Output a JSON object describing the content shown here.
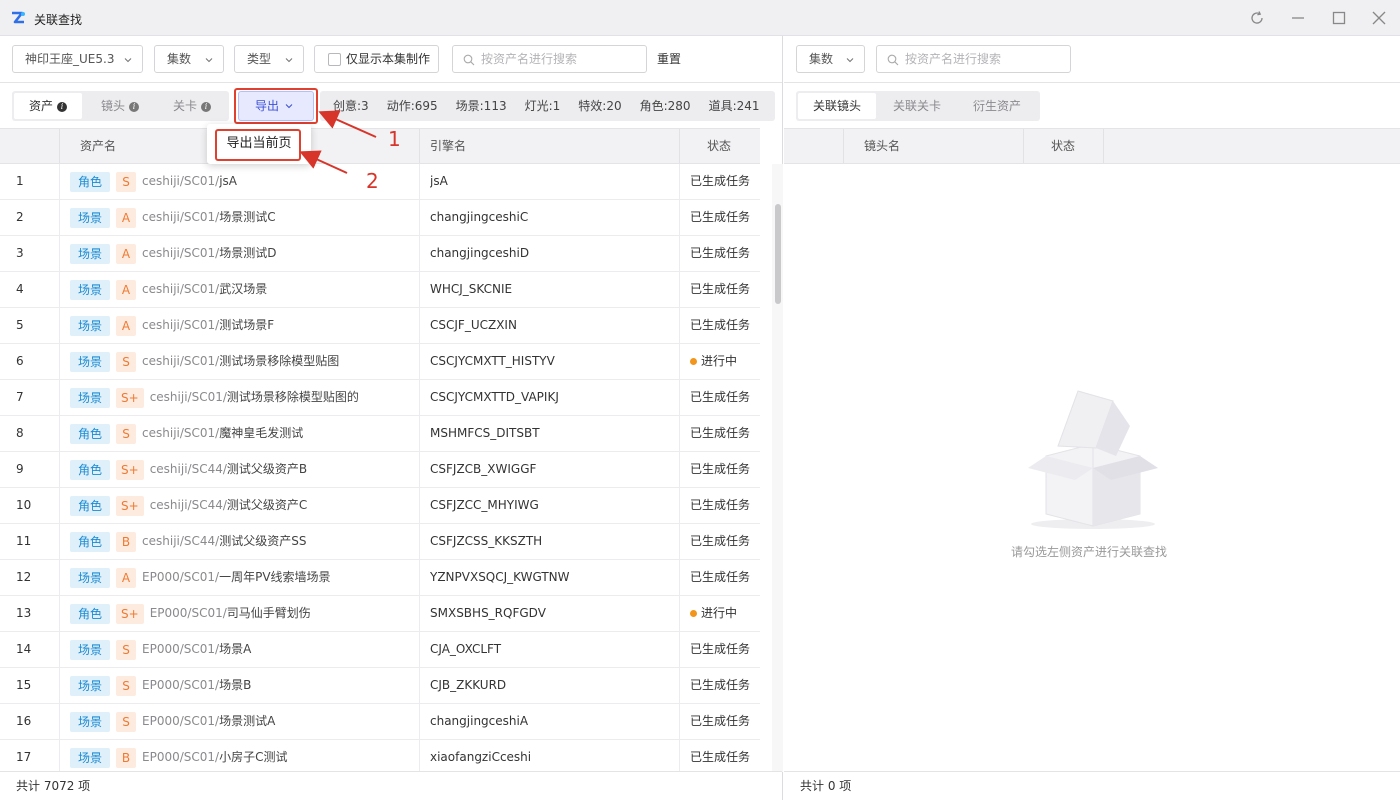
{
  "window": {
    "title": "关联查找",
    "icons": {
      "logo": "app-logo-icon",
      "refresh": "refresh-icon",
      "minimize": "minimize-icon",
      "maximize": "maximize-icon",
      "close": "close-icon"
    }
  },
  "left": {
    "filters": {
      "project": "神印王座_UE5.3",
      "episodes": "集数",
      "type": "类型",
      "only_current_label": "仅显示本集制作",
      "search_placeholder": "按资产名进行搜索",
      "reset_label": "重置"
    },
    "tabs": [
      {
        "label": "资产",
        "active": true
      },
      {
        "label": "镜头",
        "active": false
      },
      {
        "label": "关卡",
        "active": false
      }
    ],
    "export": {
      "label": "导出",
      "menu_item": "导出当前页"
    },
    "stats": [
      "创意:3",
      "动作:695",
      "场景:113",
      "灯光:1",
      "特效:20",
      "角色:280",
      "道具:241"
    ],
    "columns": {
      "asset_name": "资产名",
      "engine_name": "引擎名",
      "status": "状态"
    },
    "rows": [
      {
        "index": "1",
        "type": "角色",
        "grade": "S",
        "prefix": "ceshiji/SC01/",
        "name": "jsA",
        "engine": "jsA",
        "status": "已生成任务",
        "in_progress": false
      },
      {
        "index": "2",
        "type": "场景",
        "grade": "A",
        "prefix": "ceshiji/SC01/",
        "name": "场景测试C",
        "engine": "changjingceshiC",
        "status": "已生成任务",
        "in_progress": false
      },
      {
        "index": "3",
        "type": "场景",
        "grade": "A",
        "prefix": "ceshiji/SC01/",
        "name": "场景测试D",
        "engine": "changjingceshiD",
        "status": "已生成任务",
        "in_progress": false
      },
      {
        "index": "4",
        "type": "场景",
        "grade": "A",
        "prefix": "ceshiji/SC01/",
        "name": "武汉场景",
        "engine": "WHCJ_SKCNIE",
        "status": "已生成任务",
        "in_progress": false
      },
      {
        "index": "5",
        "type": "场景",
        "grade": "A",
        "prefix": "ceshiji/SC01/",
        "name": "测试场景F",
        "engine": "CSCJF_UCZXIN",
        "status": "已生成任务",
        "in_progress": false
      },
      {
        "index": "6",
        "type": "场景",
        "grade": "S",
        "prefix": "ceshiji/SC01/",
        "name": "测试场景移除模型贴图",
        "engine": "CSCJYCMXTT_HISTYV",
        "status": "进行中",
        "in_progress": true
      },
      {
        "index": "7",
        "type": "场景",
        "grade": "S+",
        "prefix": "ceshiji/SC01/",
        "name": "测试场景移除模型贴图的",
        "engine": "CSCJYCMXTTD_VAPIKJ",
        "status": "已生成任务",
        "in_progress": false
      },
      {
        "index": "8",
        "type": "角色",
        "grade": "S",
        "prefix": "ceshiji/SC01/",
        "name": "魔神皇毛发测试",
        "engine": "MSHMFCS_DITSBT",
        "status": "已生成任务",
        "in_progress": false
      },
      {
        "index": "9",
        "type": "角色",
        "grade": "S+",
        "prefix": "ceshiji/SC44/",
        "name": "测试父级资产B",
        "engine": "CSFJZCB_XWIGGF",
        "status": "已生成任务",
        "in_progress": false
      },
      {
        "index": "10",
        "type": "角色",
        "grade": "S+",
        "prefix": "ceshiji/SC44/",
        "name": "测试父级资产C",
        "engine": "CSFJZCC_MHYIWG",
        "status": "已生成任务",
        "in_progress": false
      },
      {
        "index": "11",
        "type": "角色",
        "grade": "B",
        "prefix": "ceshiji/SC44/",
        "name": "测试父级资产SS",
        "engine": "CSFJZCSS_KKSZTH",
        "status": "已生成任务",
        "in_progress": false
      },
      {
        "index": "12",
        "type": "场景",
        "grade": "A",
        "prefix": "EP000/SC01/",
        "name": "一周年PV线索墙场景",
        "engine": "YZNPVXSQCJ_KWGTNW",
        "status": "已生成任务",
        "in_progress": false
      },
      {
        "index": "13",
        "type": "角色",
        "grade": "S+",
        "prefix": "EP000/SC01/",
        "name": "司马仙手臂划伤",
        "engine": "SMXSBHS_RQFGDV",
        "status": "进行中",
        "in_progress": true
      },
      {
        "index": "14",
        "type": "场景",
        "grade": "S",
        "prefix": "EP000/SC01/",
        "name": "场景A",
        "engine": "CJA_OXCLFT",
        "status": "已生成任务",
        "in_progress": false
      },
      {
        "index": "15",
        "type": "场景",
        "grade": "S",
        "prefix": "EP000/SC01/",
        "name": "场景B",
        "engine": "CJB_ZKKURD",
        "status": "已生成任务",
        "in_progress": false
      },
      {
        "index": "16",
        "type": "场景",
        "grade": "S",
        "prefix": "EP000/SC01/",
        "name": "场景测试A",
        "engine": "changjingceshiA",
        "status": "已生成任务",
        "in_progress": false
      },
      {
        "index": "17",
        "type": "场景",
        "grade": "B",
        "prefix": "EP000/SC01/",
        "name": "小房子C测试",
        "engine": "xiaofangziCceshi",
        "status": "已生成任务",
        "in_progress": false
      }
    ],
    "footer": "共计 7072 项"
  },
  "right": {
    "filters": {
      "episodes": "集数",
      "search_placeholder": "按资产名进行搜索"
    },
    "tabs": [
      {
        "label": "关联镜头",
        "active": true
      },
      {
        "label": "关联关卡",
        "active": false
      },
      {
        "label": "衍生资产",
        "active": false
      }
    ],
    "columns": {
      "shot_name": "镜头名",
      "status": "状态"
    },
    "empty_text": "请勾选左侧资产进行关联查找",
    "footer": "共计 0 项"
  },
  "annotations": [
    "1",
    "2"
  ],
  "colors": {
    "accent": "#3f51d6",
    "type_tag": "#1b8ad0",
    "grade_tag": "#ee7a32",
    "in_progress": "#f2951d",
    "annotation": "#d8352a"
  }
}
